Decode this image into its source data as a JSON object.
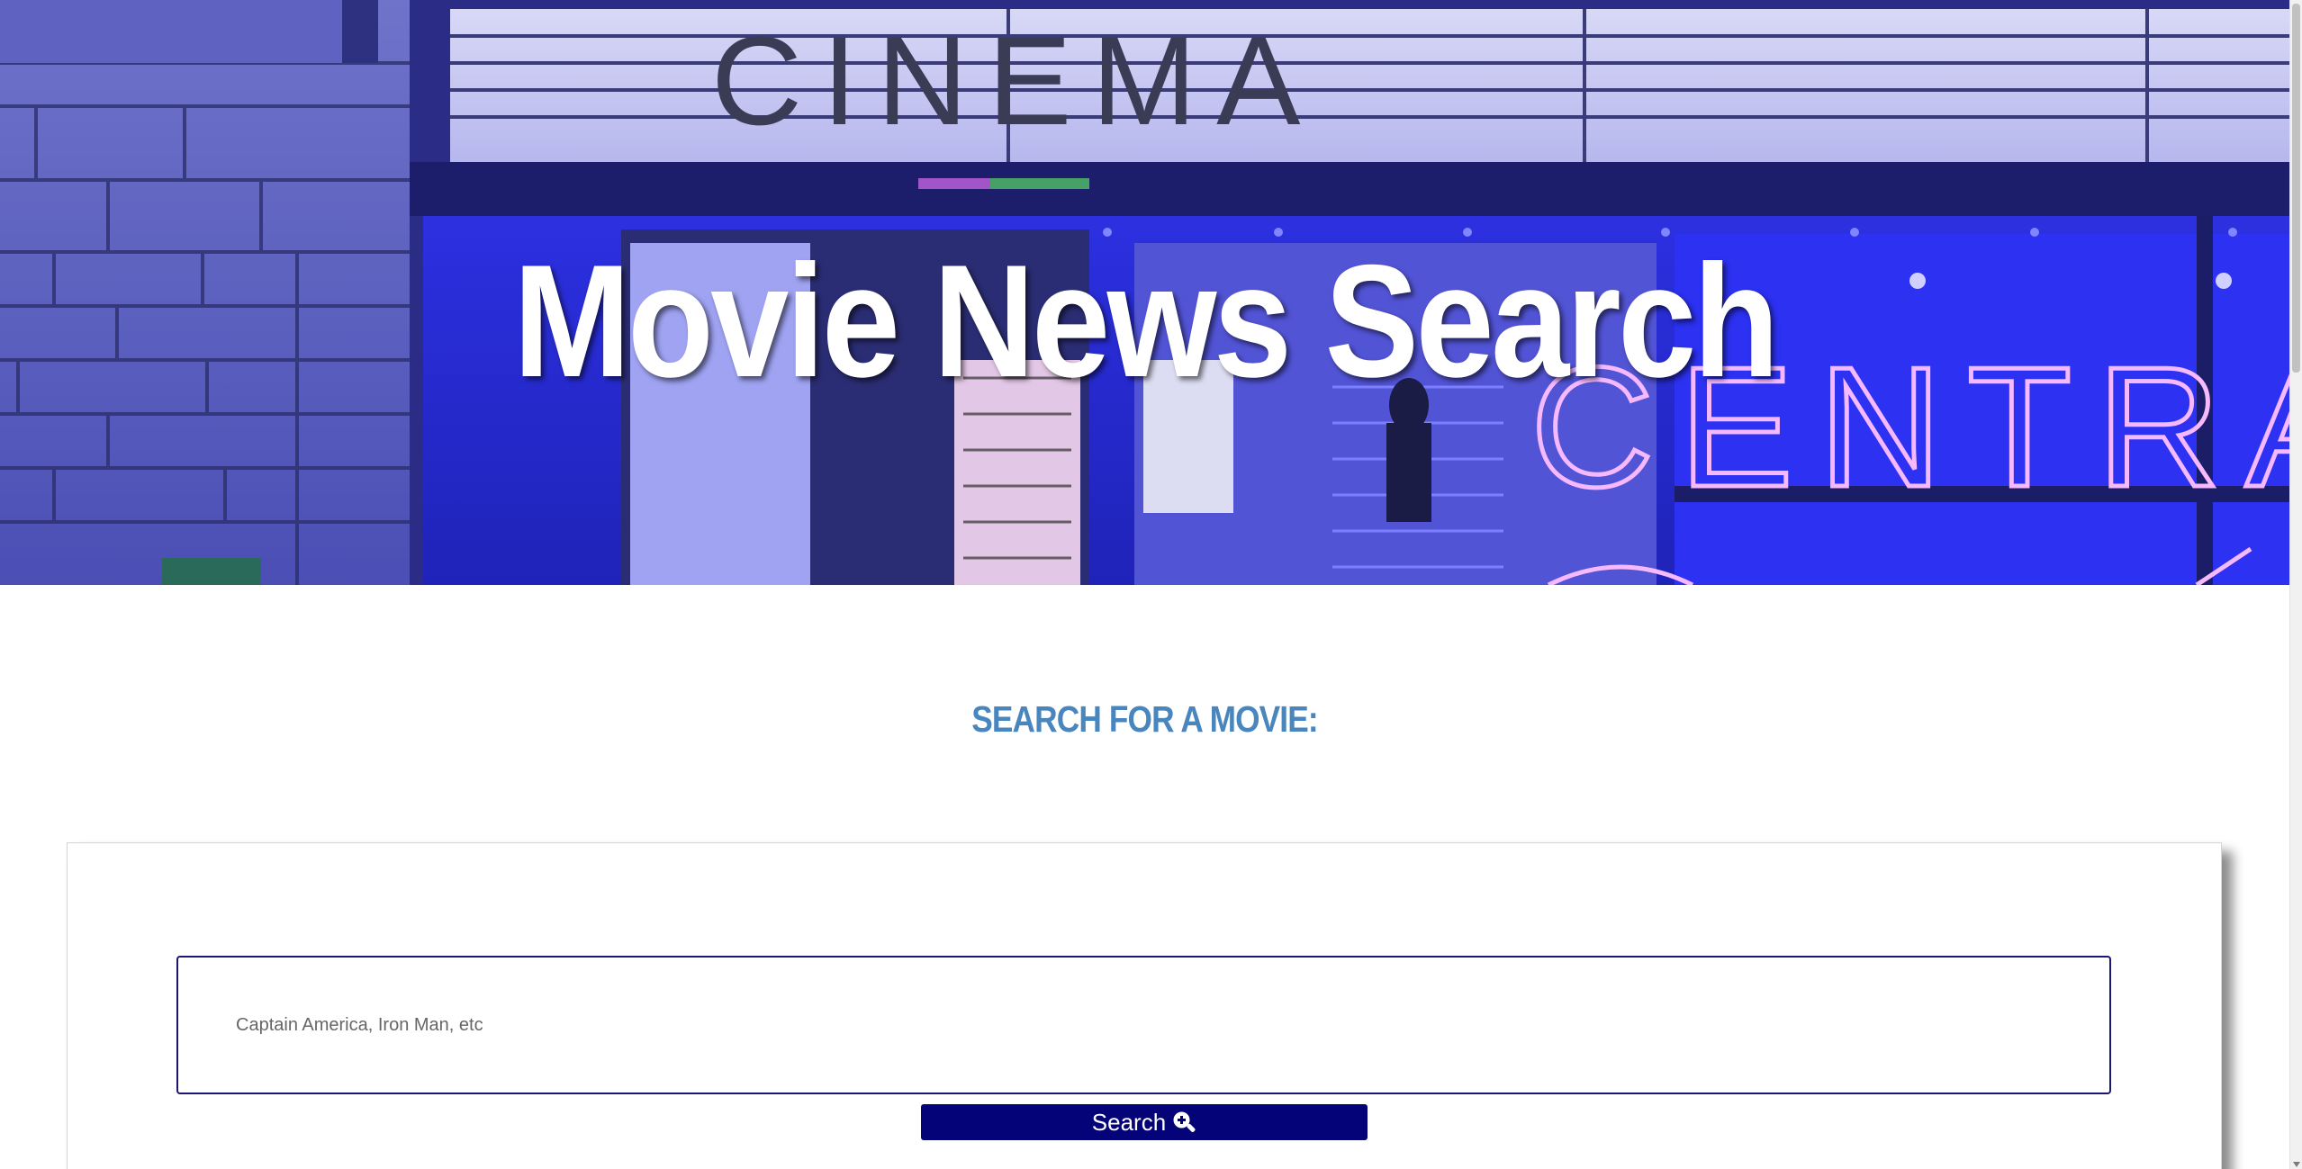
{
  "hero": {
    "title": "Movie News Search",
    "signage_top": "CINEMA",
    "signage_neon": "CENTRAL"
  },
  "search": {
    "heading": "SEARCH FOR A MOVIE:",
    "placeholder": "Captain America, Iron Man, etc",
    "button_label": "Search",
    "button_icon": "search-zoom-in-icon"
  },
  "colors": {
    "heading": "#4a86be",
    "button_bg": "#050378",
    "input_border": "#1b1573",
    "hero_tint": "#3b3fb6"
  }
}
